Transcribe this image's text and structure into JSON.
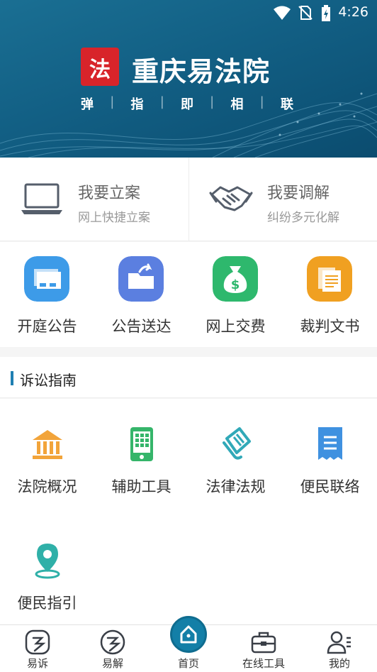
{
  "status_bar": {
    "time": "4:26",
    "icons": [
      "wifi-icon",
      "no-sim-icon",
      "battery-charging-icon"
    ]
  },
  "header": {
    "logo_text": "法",
    "title": "重庆易法院",
    "slogan": [
      "弹",
      "指",
      "即",
      "相",
      "联"
    ]
  },
  "cards": [
    {
      "title": "我要立案",
      "subtitle": "网上快捷立案",
      "icon": "laptop-icon"
    },
    {
      "title": "我要调解",
      "subtitle": "纠纷多元化解",
      "icon": "handshake-icon"
    }
  ],
  "quick_items": [
    {
      "label": "开庭公告",
      "icon": "court-notice-icon",
      "color": "#3d9be8"
    },
    {
      "label": "公告送达",
      "icon": "folder-share-icon",
      "color": "#5b7fe0"
    },
    {
      "label": "网上交费",
      "icon": "money-bag-icon",
      "color": "#2eb86d"
    },
    {
      "label": "裁判文书",
      "icon": "documents-icon",
      "color": "#f0a021"
    }
  ],
  "guide": {
    "title": "诉讼指南",
    "items": [
      {
        "label": "法院概况",
        "icon": "courthouse-icon",
        "color": "#f2a43a"
      },
      {
        "label": "辅助工具",
        "icon": "calculator-icon",
        "color": "#35b56a"
      },
      {
        "label": "法律法规",
        "icon": "scroll-icon",
        "color": "#31a9b8"
      },
      {
        "label": "便民联络",
        "icon": "receipt-icon",
        "color": "#3f91e0"
      },
      {
        "label": "便民指引",
        "icon": "location-pin-icon",
        "color": "#2fb0a8"
      }
    ]
  },
  "bottom_nav": [
    {
      "label": "易诉",
      "icon": "yisu-icon"
    },
    {
      "label": "易解",
      "icon": "yijie-icon"
    },
    {
      "label": "首页",
      "icon": "home-icon",
      "active": true
    },
    {
      "label": "在线工具",
      "icon": "toolbox-icon"
    },
    {
      "label": "我的",
      "icon": "profile-icon"
    }
  ],
  "colors": {
    "banner": "#125f84",
    "accent": "#1f7fb2",
    "logo": "#d8242a"
  }
}
